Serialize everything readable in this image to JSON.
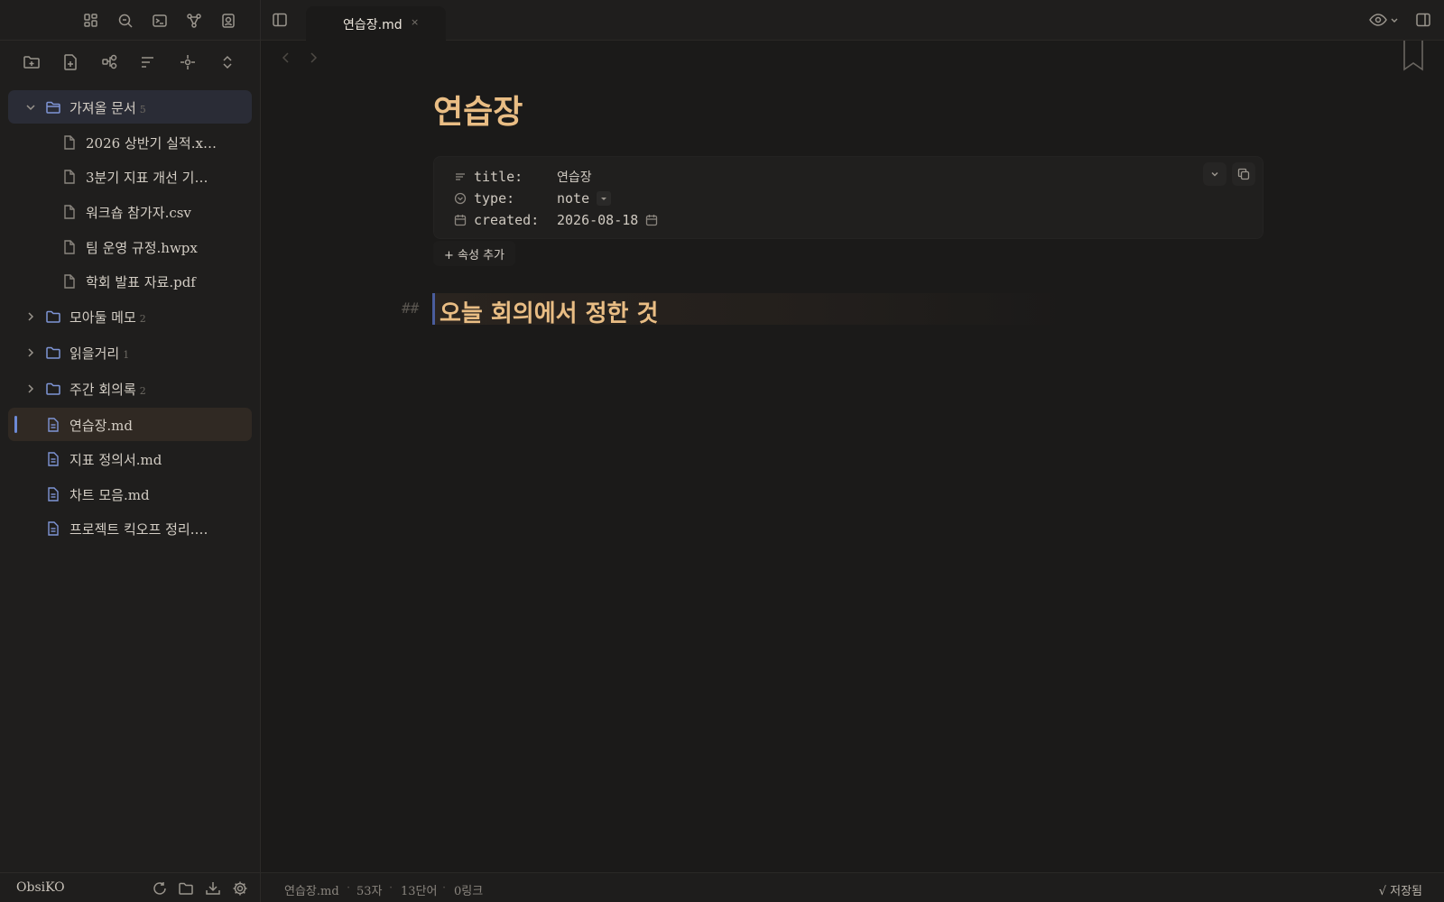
{
  "sidebar": {
    "tree": [
      {
        "type": "folder",
        "label": "가져올 문서",
        "count": "5",
        "expanded": true,
        "selected": true
      },
      {
        "type": "file",
        "label": "2026 상반기 실적.x…",
        "depth": 1
      },
      {
        "type": "file",
        "label": "3분기 지표 개선 기…",
        "depth": 1
      },
      {
        "type": "file",
        "label": "워크숍 참가자.csv",
        "depth": 1
      },
      {
        "type": "file",
        "label": "팀 운영 규정.hwpx",
        "depth": 1
      },
      {
        "type": "file",
        "label": "학회 발표 자료.pdf",
        "depth": 1
      },
      {
        "type": "folder",
        "label": "모아둘 메모",
        "count": "2",
        "expanded": false
      },
      {
        "type": "folder",
        "label": "읽을거리",
        "count": "1",
        "expanded": false
      },
      {
        "type": "folder",
        "label": "주간 회의록",
        "count": "2",
        "expanded": false
      },
      {
        "type": "md",
        "label": "연습장.md",
        "active": true
      },
      {
        "type": "md",
        "label": "지표 정의서.md"
      },
      {
        "type": "md",
        "label": "차트 모음.md"
      },
      {
        "type": "md",
        "label": "프로젝트 킥오프 정리.…"
      }
    ],
    "footer": {
      "vault_name": "ObsiKO"
    }
  },
  "tabs": [
    {
      "label": "연습장.md",
      "close": "×"
    }
  ],
  "note": {
    "title": "연습장",
    "properties": [
      {
        "key": "title:",
        "value": "연습장"
      },
      {
        "key": "type:",
        "value": "note"
      },
      {
        "key": "created:",
        "value": "2026-08-18"
      }
    ],
    "add_property": "+ 속성 추가",
    "heading_marker": "##",
    "heading": "오늘 회의에서 정한 것"
  },
  "status": {
    "file": "연습장.md",
    "chars": "53자",
    "words": "13단어",
    "links": "0링크",
    "saved": "√ 저장됨",
    "separator": "·"
  },
  "colors": {
    "accent": "#e9bd84",
    "active_bar": "#6d8ad6",
    "folder_icon": "#7f95d6"
  }
}
